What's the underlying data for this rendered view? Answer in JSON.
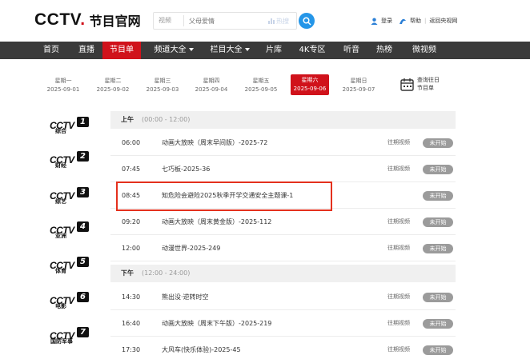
{
  "header": {
    "logo_mark": "CCTV",
    "logo_dot": ".",
    "logo_sub": "节目官网",
    "search_category": "视频",
    "search_placeholder": "父母爱情",
    "search_hot": "热搜",
    "login": "登录",
    "help": "帮助",
    "separator": "|",
    "return_old": "返回央视网"
  },
  "nav": {
    "items": [
      "首页",
      "直播",
      "节目单",
      "频道大全",
      "栏目大全",
      "片库",
      "4K专区",
      "听音",
      "热榜",
      "微视频"
    ],
    "active_index": 2
  },
  "days": [
    {
      "week": "星期一",
      "date": "2025-09-01"
    },
    {
      "week": "星期二",
      "date": "2025-09-02"
    },
    {
      "week": "星期三",
      "date": "2025-09-03"
    },
    {
      "week": "星期四",
      "date": "2025-09-04"
    },
    {
      "week": "星期五",
      "date": "2025-09-05"
    },
    {
      "week": "星期六",
      "date": "2025-09-06"
    },
    {
      "week": "星期日",
      "date": "2025-09-07"
    }
  ],
  "past_schedule": "查询往日节目单",
  "channels": [
    {
      "word": "CCTV",
      "num": "1",
      "name": "综合"
    },
    {
      "word": "CCTV",
      "num": "2",
      "name": "财经"
    },
    {
      "word": "CCTV",
      "num": "3",
      "name": "综艺"
    },
    {
      "word": "CCTV",
      "num": "4",
      "name": "亚洲"
    },
    {
      "word": "CCTV",
      "num": "5",
      "name": "体育"
    },
    {
      "word": "CCTV",
      "num": "6",
      "name": "电影"
    },
    {
      "word": "CCTV",
      "num": "7",
      "name": "国防军事"
    }
  ],
  "schedule": {
    "morning": {
      "label": "上午",
      "range": "(00:00 - 12:00)"
    },
    "afternoon": {
      "label": "下午",
      "range": "(12:00 - 24:00)"
    },
    "morning_rows": [
      {
        "time": "06:00",
        "title": "动画大放映（周末早间版）-2025-72",
        "replay": "往期视频",
        "status": "未开始"
      },
      {
        "time": "07:45",
        "title": "七巧板-2025-36",
        "replay": "往期视频",
        "status": "未开始"
      },
      {
        "time": "08:45",
        "title": "知危险会避险2025秋季开学交通安全主题课-1",
        "replay": "",
        "status": "未开始"
      },
      {
        "time": "09:20",
        "title": "动画大放映（周末黄金版）-2025-112",
        "replay": "往期视频",
        "status": "未开始"
      },
      {
        "time": "12:00",
        "title": "动漫世界-2025-249",
        "replay": "往期视频",
        "status": "未开始"
      }
    ],
    "afternoon_rows": [
      {
        "time": "14:30",
        "title": "熊出没·逆转时空",
        "replay": "往期视频",
        "status": "未开始"
      },
      {
        "time": "16:40",
        "title": "动画大放映（周末下午版）-2025-219",
        "replay": "往期视频",
        "status": "未开始"
      },
      {
        "time": "17:30",
        "title": "大风车(快乐体验)-2025-45",
        "replay": "往期视频",
        "status": "未开始"
      }
    ]
  },
  "colors": {
    "accent": "#d0121b",
    "nav_bg": "#3a3a3a",
    "search_btn": "#2596e8",
    "highlight": "#e4301d"
  }
}
